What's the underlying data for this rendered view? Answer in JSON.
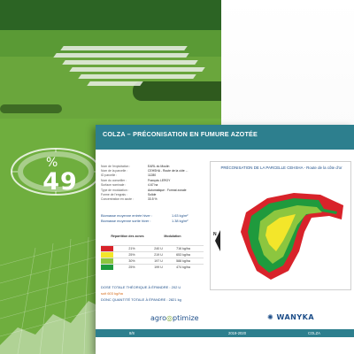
{
  "dial": {
    "value": "49",
    "unit": "%"
  },
  "card": {
    "header_title": "COLZA –  PRÉCONISATION EN FUMURE AZOTÉE",
    "info": [
      {
        "key": "Nom de l'exploitation :",
        "value": "EARL du Moulin"
      },
      {
        "key": "Nom de la parcelle :",
        "value": "CEHSHA - Route de la côte ..."
      },
      {
        "key": "ID parcelle :",
        "value": "11280"
      },
      {
        "key": "Nom du conseiller :",
        "value": "François LEROY"
      },
      {
        "key": "Surface nominale :",
        "value": "4.67 ha"
      },
      {
        "key": "Type de modulation :",
        "value": "Automatique : Format zonale"
      },
      {
        "key": "Forme de l'engrais :",
        "value": "Solide"
      },
      {
        "key": "Concentration en azote :",
        "value": "33.5 %"
      }
    ],
    "biomass": [
      {
        "key": "Biomasse moyenne entrée hiver :",
        "value": "1.63 kg/m²"
      },
      {
        "key": "Biomasse moyenne sortie hiver :",
        "value": "1.38 kg/m²"
      }
    ],
    "table": {
      "col_zones": "Répartition des zones",
      "col_modulation": "Modulation",
      "rows": [
        {
          "color": "#d8232a",
          "pct": "21%",
          "dose": "240 U",
          "kg": "716 kg/ha"
        },
        {
          "color": "#f3e62a",
          "pct": "25%",
          "dose": "219 U",
          "kg": "653 kg/ha"
        },
        {
          "color": "#8cc63f",
          "pct": "30%",
          "dose": "197 U",
          "kg": "588 kg/ha"
        },
        {
          "color": "#1f9a3d",
          "pct": "25%",
          "dose": "199 U",
          "kg": "474 kg/ha"
        }
      ]
    },
    "totals": {
      "dose_theorique": "DOSE TOTALE THÉORIQUE À ÉPANDRE : 202 U",
      "soit": "soit  603 kg/ha",
      "quantite": "DONC QUANTITÉ TOTALE À ÉPANDRE : 2821 kg"
    },
    "map": {
      "title": "PRÉCONISATION DE LA PARCELLE CEHSHA - Route de la côte d'or",
      "north": "N"
    },
    "logos": {
      "agro_a": "agro",
      "agro_b": "ptimize",
      "wanyka": "WANYKA"
    },
    "footer": {
      "page": "8/8",
      "season": "2019-2020",
      "crop": "COLZA"
    }
  }
}
